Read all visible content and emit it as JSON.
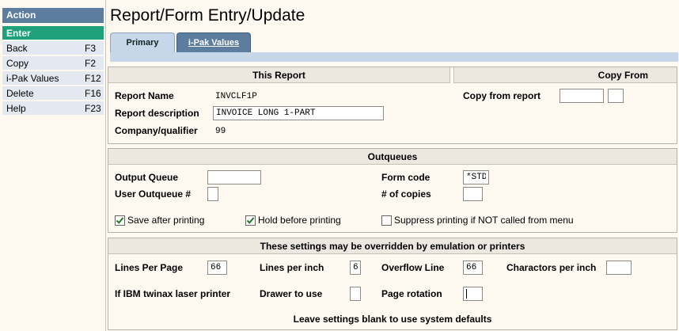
{
  "sidebar": {
    "header": "Action",
    "items": [
      {
        "label": "Enter",
        "key": ""
      },
      {
        "label": "Back",
        "key": "F3"
      },
      {
        "label": "Copy",
        "key": "F2"
      },
      {
        "label": "i-Pak Values",
        "key": "F12"
      },
      {
        "label": "Delete",
        "key": "F16"
      },
      {
        "label": "Help",
        "key": "F23"
      }
    ]
  },
  "page": {
    "title": "Report/Form Entry/Update"
  },
  "tabs": [
    {
      "label": "Primary"
    },
    {
      "label": "i-Pak Values"
    }
  ],
  "this_report": {
    "header": "This Report",
    "copy_from_header": "Copy From",
    "report_name_label": "Report Name",
    "report_name": "INVCLF1P",
    "report_desc_label": "Report description",
    "report_desc": "INVOICE LONG 1-PART",
    "company_label": "Company/qualifier",
    "company": "99",
    "copy_from_label": "Copy from report",
    "copy_from_value": "",
    "copy_from_qualifier": ""
  },
  "outqueues": {
    "header": "Outqueues",
    "output_queue_label": "Output Queue",
    "output_queue": "",
    "user_outqueue_label": "User Outqueue #",
    "user_outqueue": "",
    "form_code_label": "Form code",
    "form_code": "*STD",
    "copies_label": "# of copies",
    "copies": "",
    "save_after_label": "Save after printing",
    "save_after": true,
    "hold_before_label": "Hold before printing",
    "hold_before": true,
    "suppress_label": "Suppress printing if NOT called from menu",
    "suppress": false
  },
  "settings": {
    "header": "These settings may be overridden by emulation or printers",
    "lines_per_page_label": "Lines Per Page",
    "lines_per_page": "66",
    "lines_per_inch_label": "Lines per inch",
    "lines_per_inch": "6",
    "overflow_label": "Overflow Line",
    "overflow": "66",
    "chars_label": "Charactors per inch",
    "chars": "",
    "ibm_label": "If IBM twinax laser printer",
    "drawer_label": "Drawer to use",
    "drawer": "",
    "rotation_label": "Page rotation",
    "rotation": "",
    "footer": "Leave settings blank to use system defaults"
  },
  "colors": {
    "sidebar_header": "#5d7d9f",
    "active_item": "#1fa07a",
    "tab_active": "#c6d7ea",
    "tab_inactive": "#5d7d9f"
  }
}
